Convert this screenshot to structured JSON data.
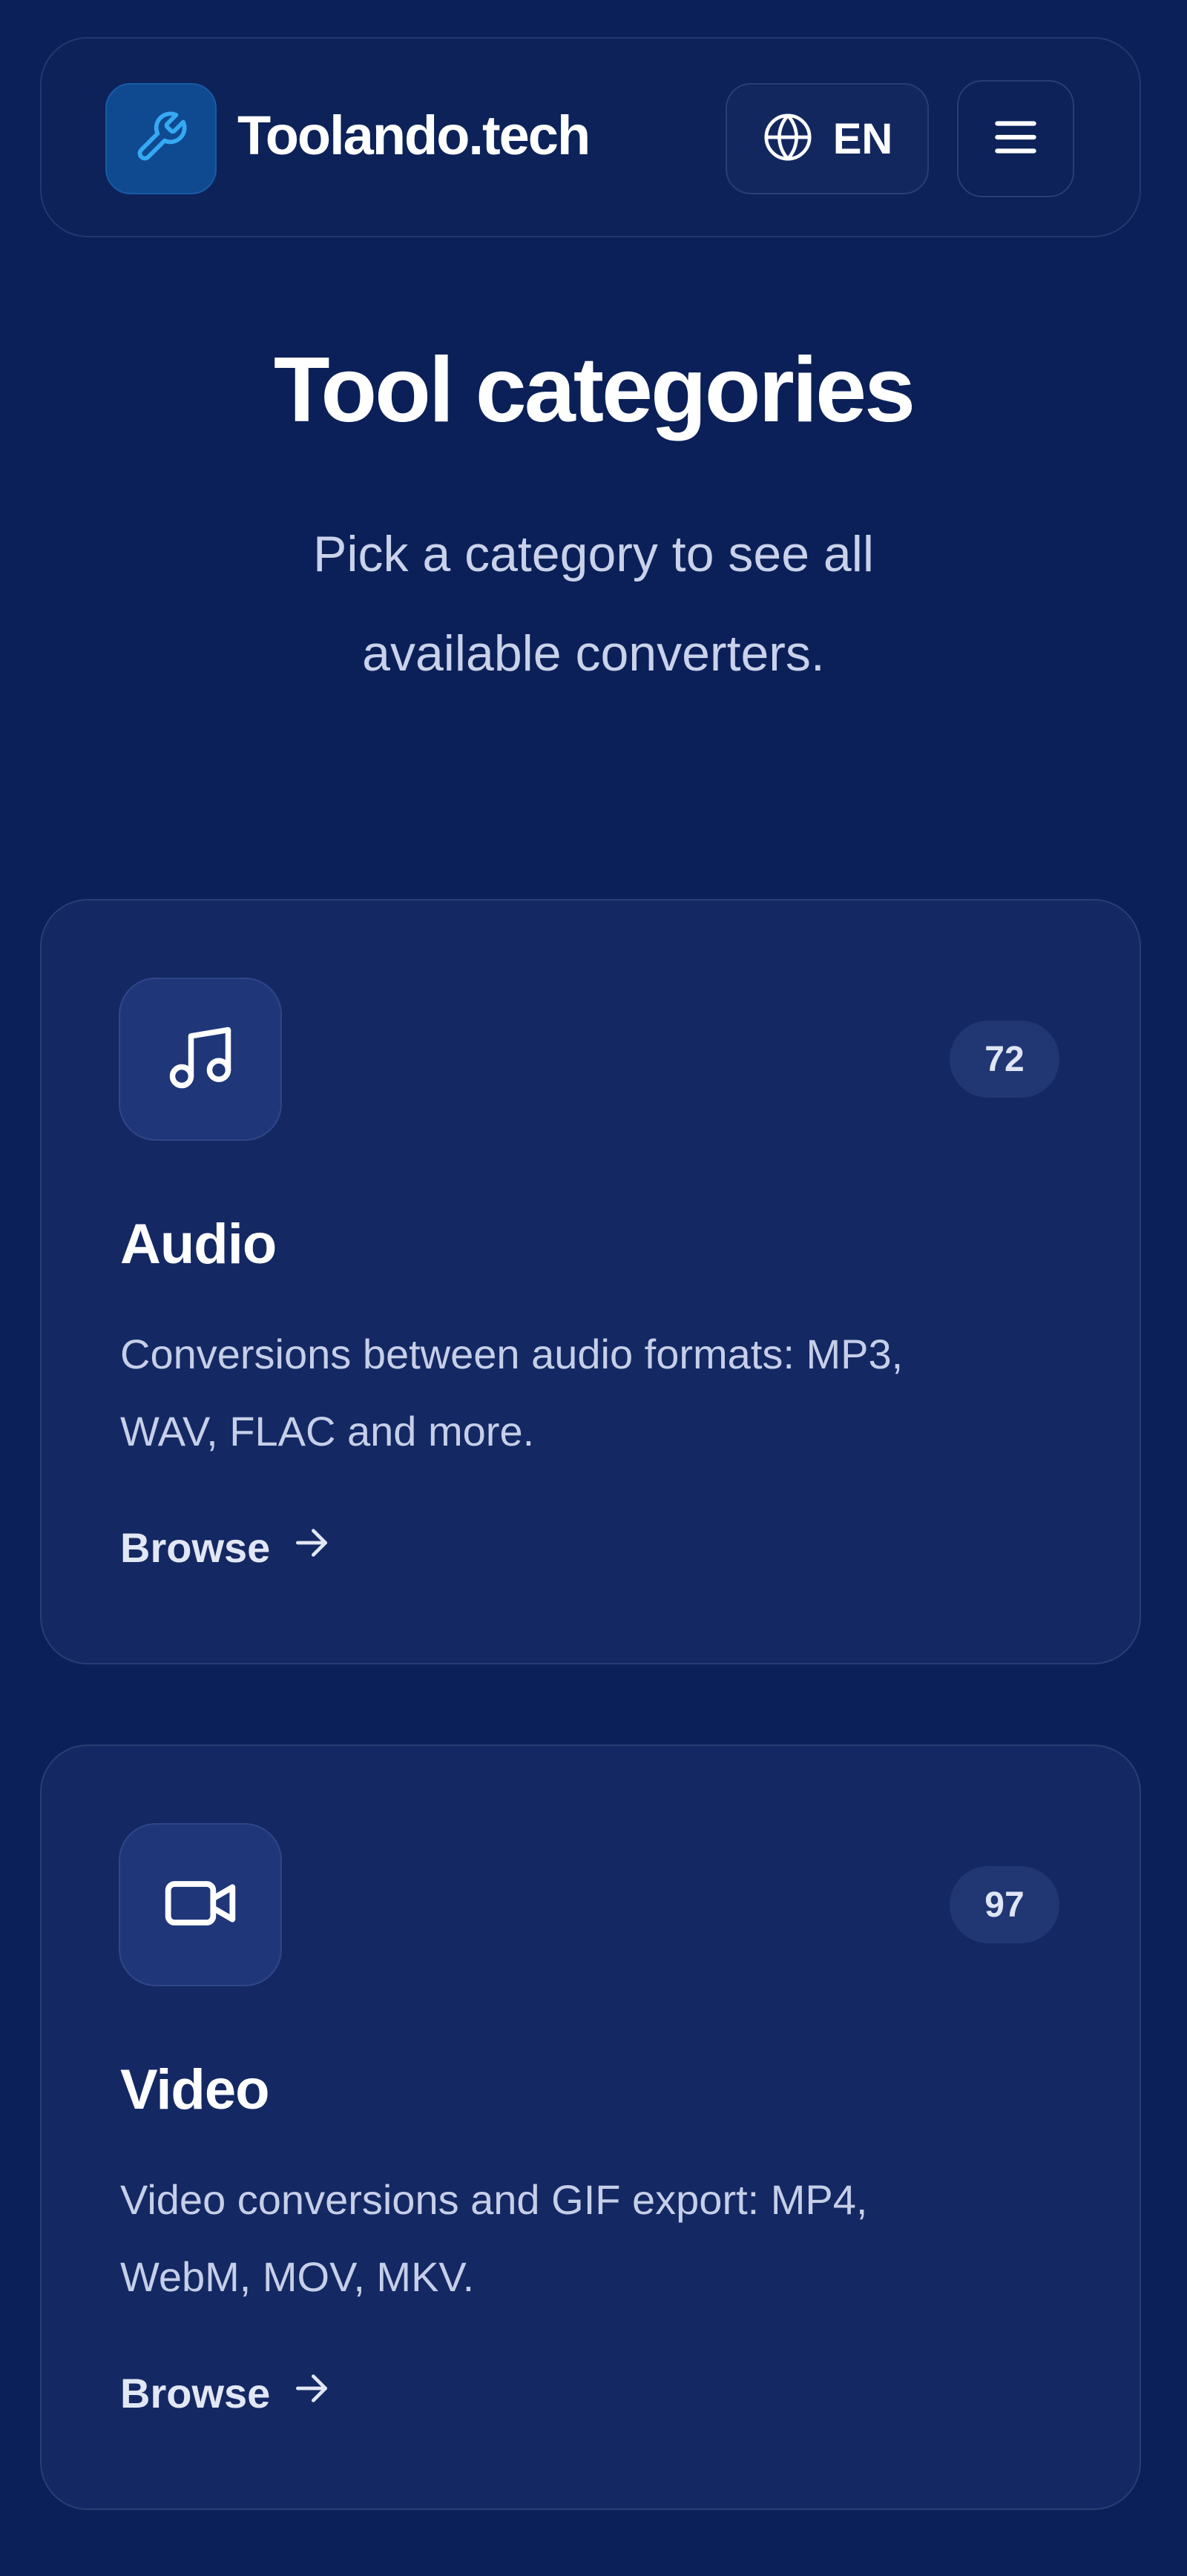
{
  "header": {
    "brand": "Toolando.tech",
    "logo_icon": "wrench-icon",
    "language_icon": "globe-icon",
    "language_label": "EN",
    "menu_icon": "hamburger-menu-icon"
  },
  "hero": {
    "title": "Tool categories",
    "subtitle_line1": "Pick a category to see all",
    "subtitle_line2": "available converters."
  },
  "categories": [
    {
      "icon": "music-note-icon",
      "count": "72",
      "title": "Audio",
      "description_line1": "Conversions between audio formats: MP3,",
      "description_line2": "WAV, FLAC and more.",
      "link_label": "Browse",
      "link_icon": "arrow-right-icon"
    },
    {
      "icon": "video-camera-icon",
      "count": "97",
      "title": "Video",
      "description_line1": "Video conversions and GIF export: MP4,",
      "description_line2": "WebM, MOV, MKV.",
      "link_label": "Browse",
      "link_icon": "arrow-right-icon"
    }
  ],
  "colors": {
    "background": "#0b2058",
    "card": "#142863",
    "accent": "#1f9bf0",
    "text": "#ffffff",
    "muted_text": "#c6cfe8"
  }
}
